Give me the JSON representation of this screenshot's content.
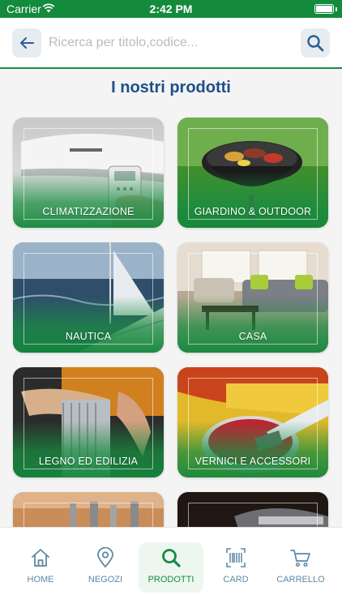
{
  "status_bar": {
    "carrier": "Carrier",
    "time": "2:42 PM"
  },
  "search": {
    "placeholder": "Ricerca per titolo,codice..."
  },
  "page_title": "I nostri prodotti",
  "products": [
    {
      "label": "CLIMATIZZAZIONE"
    },
    {
      "label": "GIARDINO & OUTDOOR"
    },
    {
      "label": "NAUTICA"
    },
    {
      "label": "CASA"
    },
    {
      "label": "LEGNO ED EDILIZIA"
    },
    {
      "label": "VERNICI E ACCESSORI"
    }
  ],
  "tabs": [
    {
      "label": "HOME",
      "icon": "home-icon"
    },
    {
      "label": "NEGOZI",
      "icon": "location-pin-icon"
    },
    {
      "label": "PRODOTTI",
      "icon": "search-icon",
      "active": true
    },
    {
      "label": "CARD",
      "icon": "barcode-icon"
    },
    {
      "label": "CARRELLO",
      "icon": "cart-icon"
    }
  ],
  "colors": {
    "brand_green": "#148a3c",
    "title_blue": "#1e4f88",
    "tab_inactive": "#5d88a4"
  }
}
